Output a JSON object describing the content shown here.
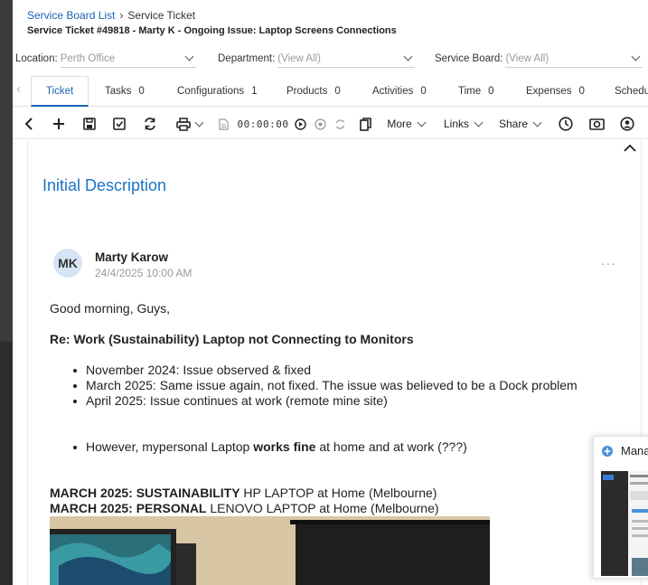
{
  "breadcrumb": {
    "parent": "Service Board List",
    "current": "Service Ticket"
  },
  "ticket_title": "Service Ticket #49818 - Marty K - Ongoing Issue: Laptop Screens Connections",
  "filters": {
    "location": {
      "label": "Location:",
      "value": "Perth Office"
    },
    "department": {
      "label": "Department:",
      "value": "(View All)"
    },
    "service_board": {
      "label": "Service Board:",
      "value": "(View All)"
    }
  },
  "tabs": [
    {
      "label": "Ticket",
      "count": ""
    },
    {
      "label": "Tasks",
      "count": "0"
    },
    {
      "label": "Configurations",
      "count": "1"
    },
    {
      "label": "Products",
      "count": "0"
    },
    {
      "label": "Activities",
      "count": "0"
    },
    {
      "label": "Time",
      "count": "0"
    },
    {
      "label": "Expenses",
      "count": "0"
    },
    {
      "label": "Schedu",
      "count": ""
    }
  ],
  "toolbar": {
    "timer": "00:00:00",
    "more_label": "More",
    "links_label": "Links",
    "share_label": "Share"
  },
  "icons": [
    "back-icon",
    "add-icon",
    "save-icon",
    "save-and-close-icon",
    "refresh-icon",
    "print-icon",
    "note-icon",
    "play-icon",
    "stop-icon",
    "reset-icon",
    "copy-icon",
    "clock-icon",
    "camera-icon",
    "user-icon"
  ],
  "section": {
    "title": "Initial Description"
  },
  "note": {
    "initials": "MK",
    "author": "Marty Karow",
    "timestamp": "24/4/2025 10:00 AM",
    "menu": "···",
    "greeting": "Good morning, Guys,",
    "subject": "Re: Work (Sustainability) Laptop not Connecting to Monitors",
    "bullets": [
      "November 2024: Issue observed & fixed",
      "March 2025: Same issue again, not fixed. The issue was believed to be a Dock problem",
      "April 2025: Issue continues at work (remote mine site)"
    ],
    "extra_bullet": {
      "before": "However, mypersonal Laptop ",
      "bold": "works fine",
      "after": " at home and at work (???)"
    },
    "line1": {
      "bold": "MARCH 2025: SUSTAINABILITY",
      "rest": " HP LAPTOP at Home (Melbourne)"
    },
    "line2": {
      "bold": "MARCH 2025: PERSONAL",
      "rest": " LENOVO LAPTOP at Home (Melbourne)"
    }
  },
  "popup": {
    "title": "Manage"
  },
  "colors": {
    "accent": "#1a63b5",
    "heading": "#1a73c5",
    "avatar_bg": "#d6e4f5"
  }
}
